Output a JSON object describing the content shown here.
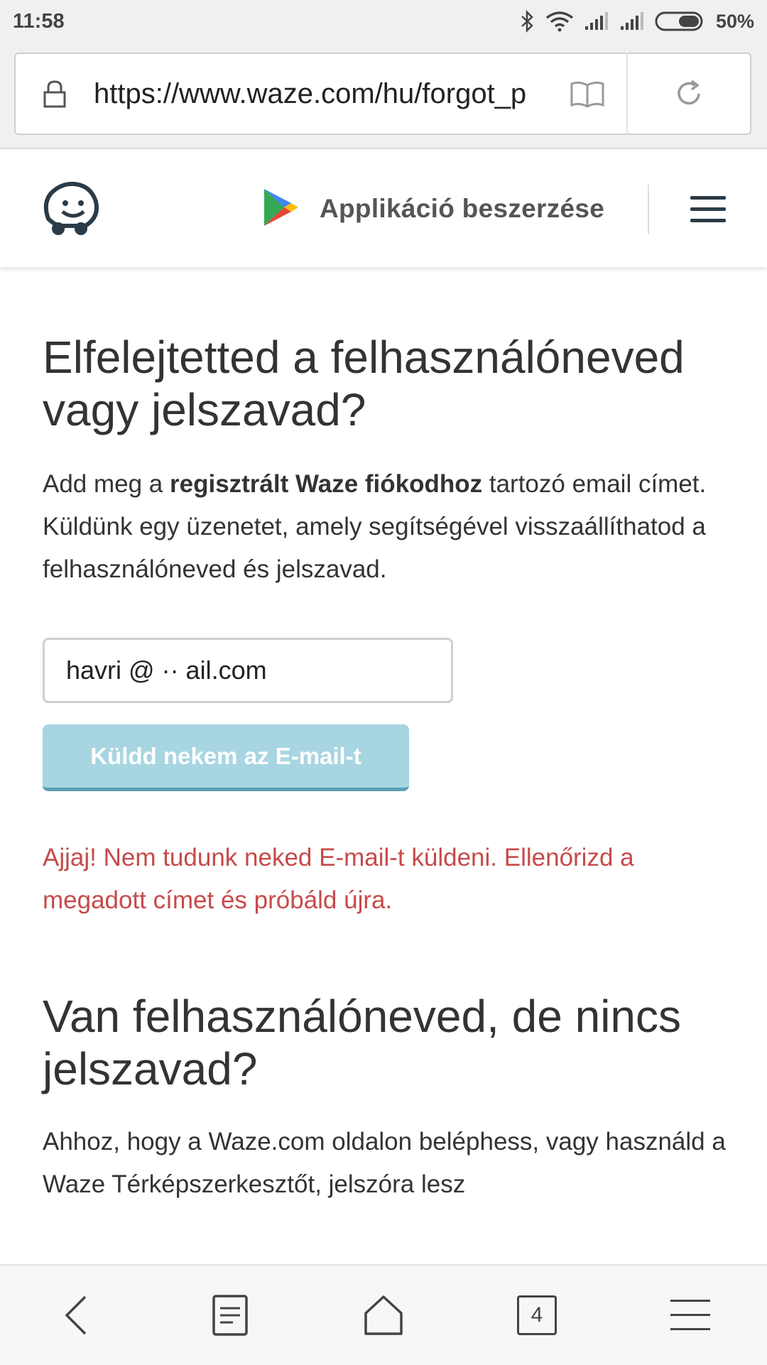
{
  "status_bar": {
    "time": "11:58",
    "battery": "50%",
    "icons": [
      "bluetooth-icon",
      "wifi-icon",
      "signal-icon",
      "signal-icon",
      "battery-icon"
    ]
  },
  "browser": {
    "url": "https://www.waze.com/hu/forgot_p",
    "tabs_count": "4"
  },
  "header": {
    "get_app_label": "Applikáció beszerzése"
  },
  "main": {
    "title": "Elfelejtetted a felhasználóneved vagy jelszavad?",
    "intro_before": "Add meg a ",
    "intro_bold": "regisztrált Waze fiókodhoz",
    "intro_after": " tartozó email címet. Küldünk egy üzenetet, amely segítségével visszaállíthatod a felhasználóneved és jelszavad.",
    "email_value": "havri    @  ·· ail.com",
    "send_button": "Küldd nekem az E-mail-t",
    "error_message": "Ajjaj! Nem tudunk neked E-mail-t küldeni. Ellenőrizd a megadott címet és próbáld újra.",
    "section2_title": "Van felhasználóneved, de nincs jelszavad?",
    "section2_text": "Ahhoz, hogy a Waze.com oldalon beléphess, vagy használd a Waze Térképszerkesztőt, jelszóra lesz"
  },
  "colors": {
    "button_bg": "#a8d5e2",
    "error": "#c74a4a"
  }
}
